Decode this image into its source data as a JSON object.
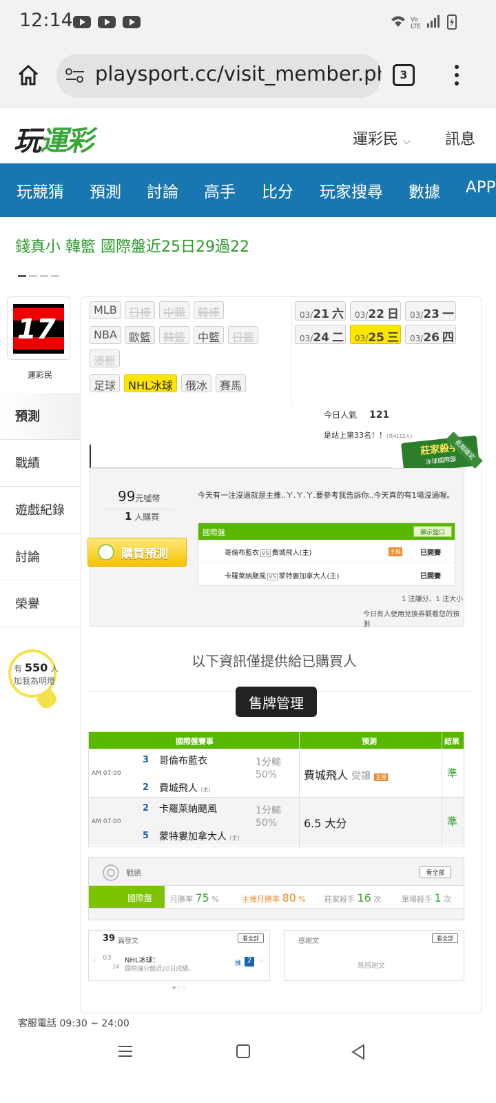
{
  "status_bar": {
    "time": "12:14"
  },
  "browser": {
    "url": "playsport.cc/visit_member.ph",
    "tab_count": "3"
  },
  "site": {
    "logo_part1": "玩",
    "logo_part2": "運彩",
    "member_menu": "運彩民",
    "messages": "訊息"
  },
  "nav": [
    "玩競猜",
    "預測",
    "討論",
    "高手",
    "比分",
    "玩家搜尋",
    "數據",
    "APP"
  ],
  "ticker": "錢真小 韓籃 國際盤近25日29過22",
  "profile": {
    "avatar_text": "17",
    "username": "運彩民"
  },
  "side_menu": [
    "預測",
    "戰績",
    "遊戲紀錄",
    "討論",
    "榮譽"
  ],
  "bulb": {
    "prefix": "有",
    "count": "550",
    "suffix": "人",
    "caption": "加我為明燈"
  },
  "sports": [
    {
      "label": "MLB",
      "state": "normal"
    },
    {
      "label": "日棒",
      "state": "disabled"
    },
    {
      "label": "中職",
      "state": "disabled"
    },
    {
      "label": "韓棒",
      "state": "disabled"
    },
    {
      "label": "NBA",
      "state": "normal"
    },
    {
      "label": "歐籃",
      "state": "normal"
    },
    {
      "label": "韓籃",
      "state": "disabled"
    },
    {
      "label": "中籃",
      "state": "normal"
    },
    {
      "label": "日籃",
      "state": "disabled"
    },
    {
      "label": "澳籃",
      "state": "disabled"
    },
    {
      "label": "足球",
      "state": "normal"
    },
    {
      "label": "NHL冰球",
      "state": "selected"
    },
    {
      "label": "俄冰",
      "state": "normal"
    },
    {
      "label": "賽馬",
      "state": "normal"
    }
  ],
  "dates": [
    {
      "md": "03/",
      "day": "21",
      "wd": "六"
    },
    {
      "md": "03/",
      "day": "22",
      "wd": "日"
    },
    {
      "md": "03/",
      "day": "23",
      "wd": "一"
    },
    {
      "md": "03/",
      "day": "24",
      "wd": "二"
    },
    {
      "md": "03/",
      "day": "25",
      "wd": "三",
      "selected": true
    },
    {
      "md": "03/",
      "day": "26",
      "wd": "四"
    }
  ],
  "popularity": {
    "label": "今日人氣",
    "value": "121",
    "rank": "是站上第33名！！",
    "rank_note": "(共4112人)"
  },
  "killer_badge": {
    "title": "莊家殺手",
    "sub": "冰球國際盤",
    "ribbon": "長期穩定"
  },
  "prediction": {
    "price": "99",
    "price_unit": "元噓幣",
    "buyers": "1",
    "buyers_unit": "人購買",
    "buy_button": "購買預測",
    "description": "今天有一注沒過就是主推..ㄚ.ㄚ.ㄚ.要參考我告訴你..今天真的有1場沒過喔。",
    "table_title": "國際盤",
    "show_odds": "顯示盤口",
    "games": [
      {
        "away": "哥倫布藍衣",
        "home": "費城飛人(主)",
        "tag": "主推",
        "status": "已開賽"
      },
      {
        "away": "卡羅萊納颶風",
        "home": "蒙特婁加拿大人(主)",
        "tag": "",
        "status": "已開賽"
      }
    ],
    "summary": "1 注讓分、1 注大小",
    "coupon_note": "今日有人使用兌換券觀看您的預測"
  },
  "notice": "以下資訊僅提供給已購買人",
  "badge_manage": "售牌管理",
  "match_table": {
    "headers": [
      "國際盤賽事",
      "預測",
      "結果"
    ],
    "rows": [
      {
        "time": "AM 07:00",
        "away_num": "3",
        "away": "哥倫布藍衣",
        "home_num": "2",
        "home": "費城飛人",
        "home_mark": "(主)",
        "line1": "1分輸",
        "line2": "50%",
        "pick": "費城飛人",
        "pick_suffix": "受讓",
        "pick_tag": "主推",
        "result": "準"
      },
      {
        "time": "AM 07:00",
        "away_num": "2",
        "away": "卡羅萊納颶風",
        "home_num": "5",
        "home": "蒙特婁加拿大人",
        "home_mark": "(主)",
        "line1": "1分輸",
        "line2": "50%",
        "pick": "6.5 大分",
        "pick_suffix": "",
        "pick_tag": "",
        "result": "準"
      }
    ]
  },
  "record": {
    "label": "戰績",
    "view_all": "看全部",
    "market": "國際盤",
    "monthly_rate_label": "月勝率",
    "monthly_rate": "75",
    "pct": "%",
    "main_rate_label": "主推月勝率",
    "main_rate": "80",
    "killer_label": "莊家殺手",
    "killer_count": "16",
    "unit": "次",
    "single_label": "單場殺手",
    "single_count": "1"
  },
  "posts": {
    "count": "39",
    "label": "篇發文",
    "view_all": "看全部",
    "date_m": "03",
    "date_d": "24",
    "title": "NHL冰球：",
    "snippet": "國際讓分盤近20日成績。",
    "push_label": "推",
    "push_count": "2"
  },
  "thanks": {
    "label": "感謝文",
    "view_all": "看全部",
    "empty": "無感謝文"
  },
  "footer": "客服電話 09:30 ~ 24:00"
}
